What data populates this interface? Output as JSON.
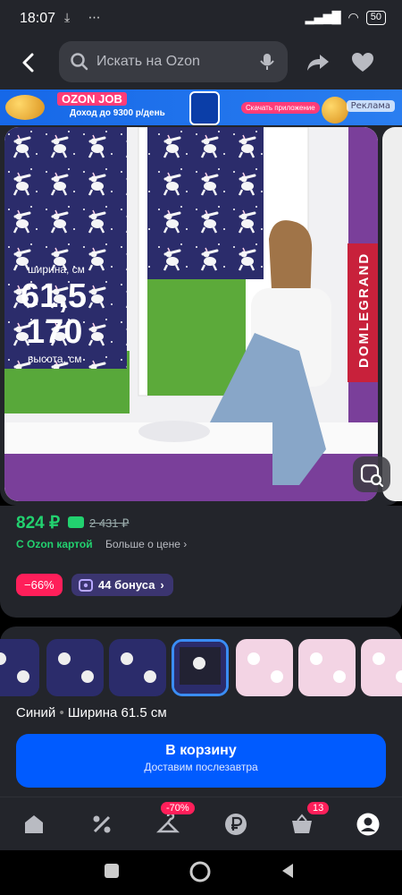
{
  "status": {
    "time": "18:07",
    "battery": "50"
  },
  "search": {
    "placeholder": "Искать на Ozon"
  },
  "banner": {
    "title": "OZON JOB",
    "subtitle": "Доход до 9300 р/день",
    "cta": "Скачать приложение",
    "ad_label": "Реклама"
  },
  "photo": {
    "width_label": "ширина, см",
    "width_value": "61,5",
    "height_value": "170",
    "height_label": "высота, см",
    "brand": "DOMLEGRAND"
  },
  "price": {
    "current": "824 ₽",
    "old": "2 431 ₽",
    "card_label": "С Ozon картой",
    "more_label": "Больше о цене"
  },
  "badges": {
    "discount": "−66%",
    "bonus": "44 бонуса"
  },
  "variant": {
    "color": "Синий",
    "size": "Ширина 61.5 см"
  },
  "cart": {
    "label": "В корзину",
    "delivery": "Доставим послезавтра"
  },
  "tabbar": {
    "discount_badge": "-70%",
    "cart_count": "13"
  },
  "colors": {
    "accent": "#005bff",
    "price_green": "#22d16f",
    "discount_red": "#ff1f5a"
  }
}
